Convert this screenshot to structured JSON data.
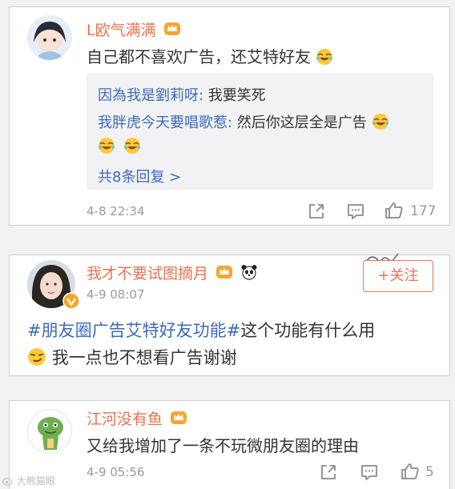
{
  "comments": [
    {
      "username": "L欧气满满",
      "text": "自己都不喜欢广告，还艾特好友",
      "replies": [
        {
          "name": "因為我是劉莉呀:",
          "text": " 我要笑死"
        },
        {
          "name": "我胖虎今天要唱歌惹:",
          "text": " 然后你这层全是广告"
        }
      ],
      "more_replies": "共8条回复 >",
      "time": "4-8 22:34",
      "likes": "177"
    },
    {
      "username": "我才不要试图摘月",
      "time": "4-9 08:07",
      "follow_label": "+关注",
      "hashtag": "#朋友圈广告艾特好友功能#",
      "text_line1": "这个功能有什么用",
      "text_line2": "我一点也不想看广告谢谢"
    },
    {
      "username": "江河没有鱼",
      "text": "又给我增加了一条不玩微朋友圈的理由",
      "time": "4-9 05:56",
      "likes": "5"
    }
  ],
  "watermark": "大熊猫眼",
  "colors": {
    "username": "#eb7350",
    "link": "#3d6ab8",
    "meta": "#9a9a9a"
  }
}
